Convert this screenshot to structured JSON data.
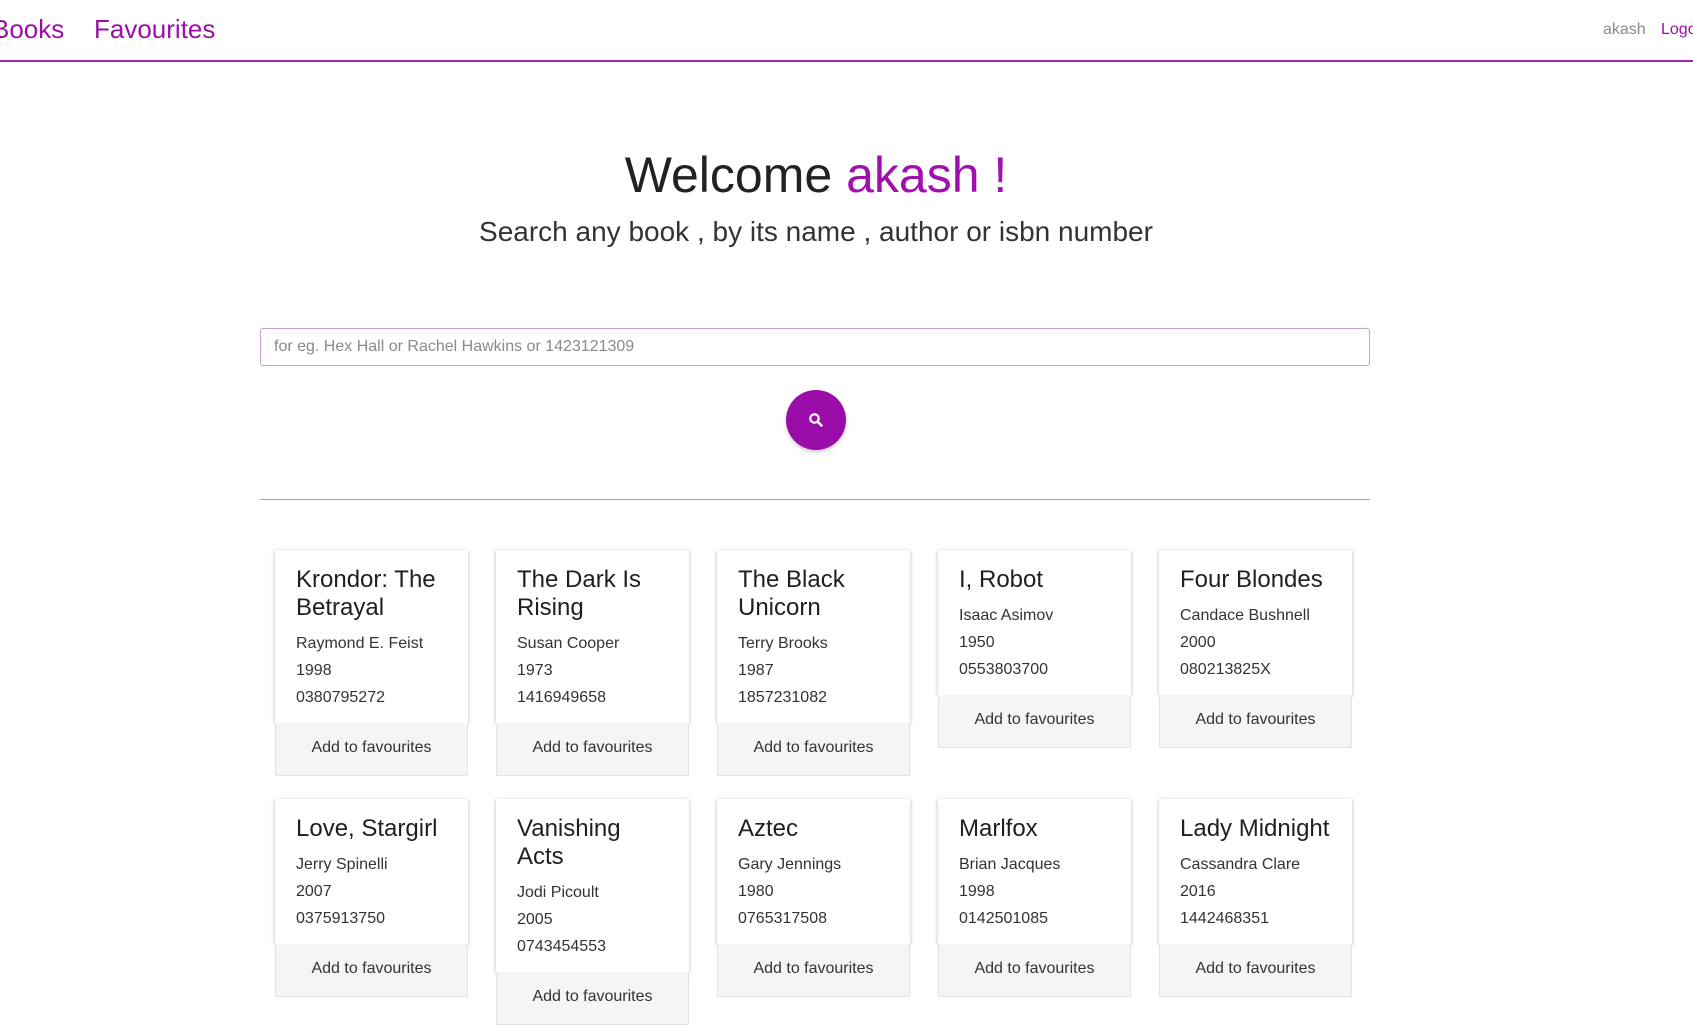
{
  "nav": {
    "books": "Books",
    "favourites": "Favourites",
    "username": "akash",
    "logout": "Logout"
  },
  "hero": {
    "welcome": "Welcome",
    "name": "akash !",
    "subtitle": "Search any book , by its name , author or isbn number"
  },
  "search": {
    "placeholder": "for eg. Hex Hall or Rachel Hawkins or 1423121309",
    "value": ""
  },
  "colors": {
    "accent": "#9b0da8",
    "divider": "#c98bd0"
  },
  "add_label": "Add to favourites",
  "books": [
    {
      "title": "Krondor: The Betrayal",
      "author": "Raymond E. Feist",
      "year": "1998",
      "isbn": "0380795272"
    },
    {
      "title": "The Dark Is Rising",
      "author": "Susan Cooper",
      "year": "1973",
      "isbn": "1416949658"
    },
    {
      "title": "The Black Unicorn",
      "author": "Terry Brooks",
      "year": "1987",
      "isbn": "1857231082"
    },
    {
      "title": "I, Robot",
      "author": "Isaac Asimov",
      "year": "1950",
      "isbn": "0553803700"
    },
    {
      "title": "Four Blondes",
      "author": "Candace Bushnell",
      "year": "2000",
      "isbn": "080213825X"
    },
    {
      "title": "Love, Stargirl",
      "author": "Jerry Spinelli",
      "year": "2007",
      "isbn": "0375913750"
    },
    {
      "title": "Vanishing Acts",
      "author": "Jodi Picoult",
      "year": "2005",
      "isbn": "0743454553"
    },
    {
      "title": "Aztec",
      "author": "Gary Jennings",
      "year": "1980",
      "isbn": "0765317508"
    },
    {
      "title": "Marlfox",
      "author": "Brian Jacques",
      "year": "1998",
      "isbn": "0142501085"
    },
    {
      "title": "Lady Midnight",
      "author": "Cassandra Clare",
      "year": "2016",
      "isbn": "1442468351"
    }
  ]
}
